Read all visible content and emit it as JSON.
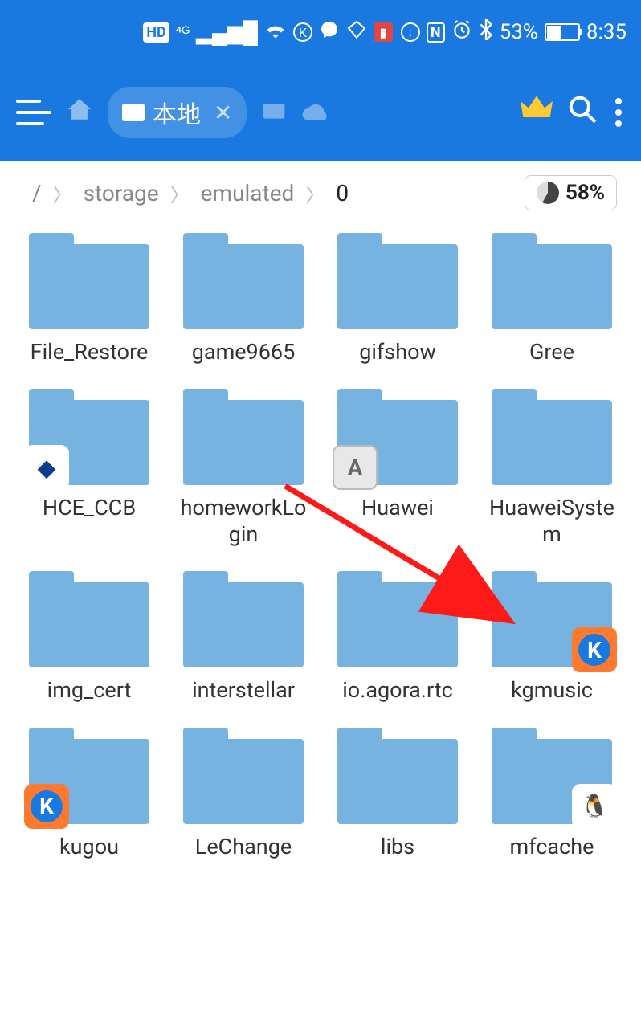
{
  "status": {
    "hd": "HD",
    "signal": "4G",
    "battery_pct": "53%",
    "time": "8:35"
  },
  "toolbar": {
    "tab_label": "本地"
  },
  "breadcrumb": {
    "root": "/",
    "parts": [
      "storage",
      "emulated",
      "0"
    ],
    "storage_pct": "58%"
  },
  "folders": [
    {
      "name": "File_Restore"
    },
    {
      "name": "game9665"
    },
    {
      "name": "gifshow"
    },
    {
      "name": "Gree"
    },
    {
      "name": "HCE_CCB",
      "badge": {
        "pos": "left",
        "bg": "#fff",
        "fg": "#0a3d8f",
        "text": "◆"
      }
    },
    {
      "name": "homeworkLogin"
    },
    {
      "name": "Huawei",
      "badge": {
        "pos": "left",
        "bg": "#e8e8e8",
        "fg": "#666",
        "text": "A",
        "border": "#bbb"
      }
    },
    {
      "name": "HuaweiSystem"
    },
    {
      "name": "img_cert"
    },
    {
      "name": "interstellar"
    },
    {
      "name": "io.agora.rtc"
    },
    {
      "name": "kgmusic",
      "badge": {
        "pos": "right",
        "bg": "#ff7a2e",
        "fg": "#fff",
        "text": "K",
        "circle": "#1a79e0"
      }
    },
    {
      "name": "kugou",
      "badge": {
        "pos": "left",
        "bg": "#ff7a2e",
        "fg": "#fff",
        "text": "K",
        "circle": "#1a79e0"
      }
    },
    {
      "name": "LeChange"
    },
    {
      "name": "libs"
    },
    {
      "name": "mfcache",
      "badge": {
        "pos": "right",
        "bg": "#fff",
        "fg": "#000",
        "text": "🐧"
      }
    }
  ],
  "annotation": {
    "arrow_target": "kgmusic"
  }
}
